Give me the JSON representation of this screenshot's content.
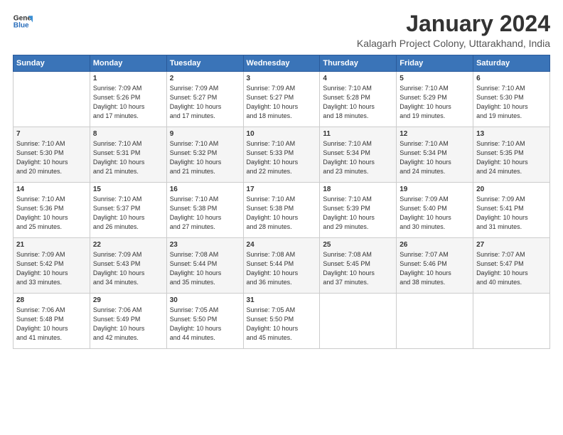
{
  "logo": {
    "line1": "General",
    "line2": "Blue"
  },
  "title": "January 2024",
  "location": "Kalagarh Project Colony, Uttarakhand, India",
  "headers": [
    "Sunday",
    "Monday",
    "Tuesday",
    "Wednesday",
    "Thursday",
    "Friday",
    "Saturday"
  ],
  "weeks": [
    [
      {
        "day": "",
        "content": ""
      },
      {
        "day": "1",
        "content": "Sunrise: 7:09 AM\nSunset: 5:26 PM\nDaylight: 10 hours\nand 17 minutes."
      },
      {
        "day": "2",
        "content": "Sunrise: 7:09 AM\nSunset: 5:27 PM\nDaylight: 10 hours\nand 17 minutes."
      },
      {
        "day": "3",
        "content": "Sunrise: 7:09 AM\nSunset: 5:27 PM\nDaylight: 10 hours\nand 18 minutes."
      },
      {
        "day": "4",
        "content": "Sunrise: 7:10 AM\nSunset: 5:28 PM\nDaylight: 10 hours\nand 18 minutes."
      },
      {
        "day": "5",
        "content": "Sunrise: 7:10 AM\nSunset: 5:29 PM\nDaylight: 10 hours\nand 19 minutes."
      },
      {
        "day": "6",
        "content": "Sunrise: 7:10 AM\nSunset: 5:30 PM\nDaylight: 10 hours\nand 19 minutes."
      }
    ],
    [
      {
        "day": "7",
        "content": "Sunrise: 7:10 AM\nSunset: 5:30 PM\nDaylight: 10 hours\nand 20 minutes."
      },
      {
        "day": "8",
        "content": "Sunrise: 7:10 AM\nSunset: 5:31 PM\nDaylight: 10 hours\nand 21 minutes."
      },
      {
        "day": "9",
        "content": "Sunrise: 7:10 AM\nSunset: 5:32 PM\nDaylight: 10 hours\nand 21 minutes."
      },
      {
        "day": "10",
        "content": "Sunrise: 7:10 AM\nSunset: 5:33 PM\nDaylight: 10 hours\nand 22 minutes."
      },
      {
        "day": "11",
        "content": "Sunrise: 7:10 AM\nSunset: 5:34 PM\nDaylight: 10 hours\nand 23 minutes."
      },
      {
        "day": "12",
        "content": "Sunrise: 7:10 AM\nSunset: 5:34 PM\nDaylight: 10 hours\nand 24 minutes."
      },
      {
        "day": "13",
        "content": "Sunrise: 7:10 AM\nSunset: 5:35 PM\nDaylight: 10 hours\nand 24 minutes."
      }
    ],
    [
      {
        "day": "14",
        "content": "Sunrise: 7:10 AM\nSunset: 5:36 PM\nDaylight: 10 hours\nand 25 minutes."
      },
      {
        "day": "15",
        "content": "Sunrise: 7:10 AM\nSunset: 5:37 PM\nDaylight: 10 hours\nand 26 minutes."
      },
      {
        "day": "16",
        "content": "Sunrise: 7:10 AM\nSunset: 5:38 PM\nDaylight: 10 hours\nand 27 minutes."
      },
      {
        "day": "17",
        "content": "Sunrise: 7:10 AM\nSunset: 5:38 PM\nDaylight: 10 hours\nand 28 minutes."
      },
      {
        "day": "18",
        "content": "Sunrise: 7:10 AM\nSunset: 5:39 PM\nDaylight: 10 hours\nand 29 minutes."
      },
      {
        "day": "19",
        "content": "Sunrise: 7:09 AM\nSunset: 5:40 PM\nDaylight: 10 hours\nand 30 minutes."
      },
      {
        "day": "20",
        "content": "Sunrise: 7:09 AM\nSunset: 5:41 PM\nDaylight: 10 hours\nand 31 minutes."
      }
    ],
    [
      {
        "day": "21",
        "content": "Sunrise: 7:09 AM\nSunset: 5:42 PM\nDaylight: 10 hours\nand 33 minutes."
      },
      {
        "day": "22",
        "content": "Sunrise: 7:09 AM\nSunset: 5:43 PM\nDaylight: 10 hours\nand 34 minutes."
      },
      {
        "day": "23",
        "content": "Sunrise: 7:08 AM\nSunset: 5:44 PM\nDaylight: 10 hours\nand 35 minutes."
      },
      {
        "day": "24",
        "content": "Sunrise: 7:08 AM\nSunset: 5:44 PM\nDaylight: 10 hours\nand 36 minutes."
      },
      {
        "day": "25",
        "content": "Sunrise: 7:08 AM\nSunset: 5:45 PM\nDaylight: 10 hours\nand 37 minutes."
      },
      {
        "day": "26",
        "content": "Sunrise: 7:07 AM\nSunset: 5:46 PM\nDaylight: 10 hours\nand 38 minutes."
      },
      {
        "day": "27",
        "content": "Sunrise: 7:07 AM\nSunset: 5:47 PM\nDaylight: 10 hours\nand 40 minutes."
      }
    ],
    [
      {
        "day": "28",
        "content": "Sunrise: 7:06 AM\nSunset: 5:48 PM\nDaylight: 10 hours\nand 41 minutes."
      },
      {
        "day": "29",
        "content": "Sunrise: 7:06 AM\nSunset: 5:49 PM\nDaylight: 10 hours\nand 42 minutes."
      },
      {
        "day": "30",
        "content": "Sunrise: 7:05 AM\nSunset: 5:50 PM\nDaylight: 10 hours\nand 44 minutes."
      },
      {
        "day": "31",
        "content": "Sunrise: 7:05 AM\nSunset: 5:50 PM\nDaylight: 10 hours\nand 45 minutes."
      },
      {
        "day": "",
        "content": ""
      },
      {
        "day": "",
        "content": ""
      },
      {
        "day": "",
        "content": ""
      }
    ]
  ]
}
